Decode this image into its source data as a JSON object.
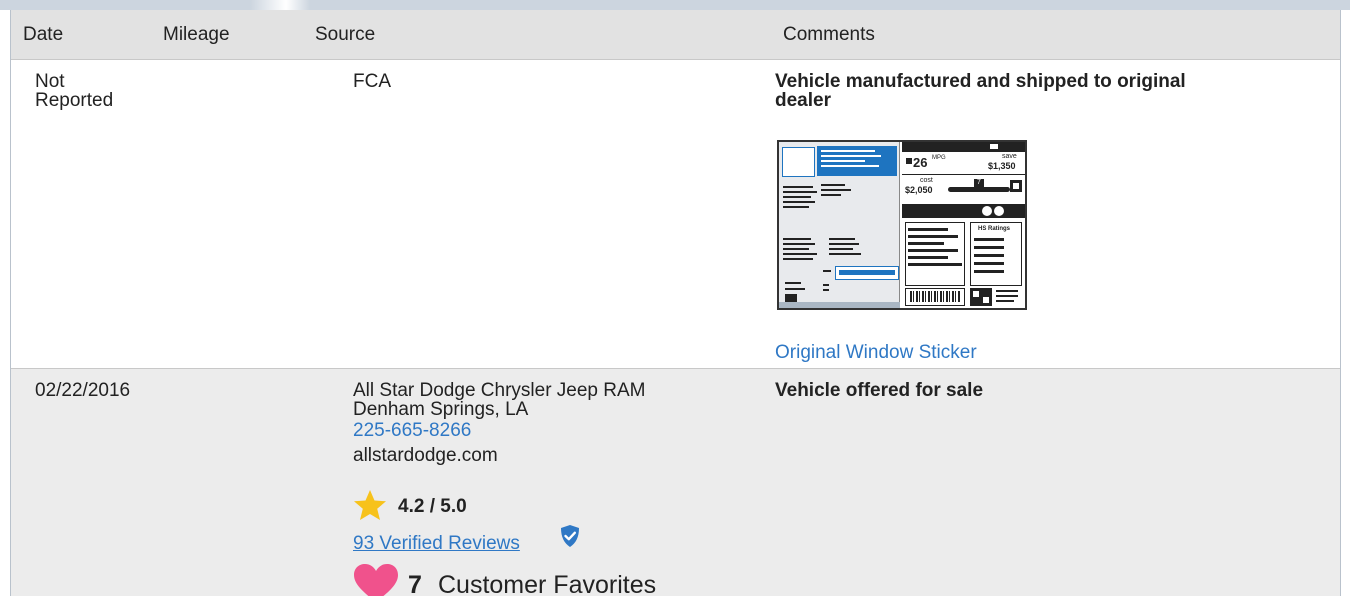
{
  "table": {
    "headers": {
      "date": "Date",
      "mileage": "Mileage",
      "source": "Source",
      "comments": "Comments"
    },
    "rows": [
      {
        "date_line1": "Not",
        "date_line2": "Reported",
        "source": "FCA",
        "comment_line1": "Vehicle manufactured and shipped to original",
        "comment_line2": "dealer",
        "sticker": {
          "mpg": "26",
          "mpg_unit": "MPG",
          "save_label": "save",
          "save_amount": "$1,350",
          "cost_label": "cost",
          "cost_amount": "$2,050",
          "ratings_label": "HS Ratings",
          "rating_value": "7"
        },
        "link": "Original Window Sticker"
      },
      {
        "date": "02/22/2016",
        "source_name": "All Star Dodge Chrysler Jeep RAM",
        "source_location": "Denham Springs, LA",
        "source_phone": "225-665-8266",
        "source_website": "allstardodge.com",
        "rating": "4.2 / 5.0",
        "reviews_link": "93 Verified Reviews",
        "favorites_count": "7",
        "favorites_label": "Customer Favorites",
        "comment": "Vehicle offered for sale"
      }
    ]
  },
  "icons": {
    "star": "star-icon",
    "verified": "verified-shield-icon",
    "heart": "heart-icon"
  },
  "colors": {
    "link": "#2f78c5",
    "header_bg": "#e2e2e2",
    "alt_row_bg": "#ececec",
    "star": "#f7c21b",
    "heart": "#f0528c",
    "verified": "#2f78c5"
  }
}
